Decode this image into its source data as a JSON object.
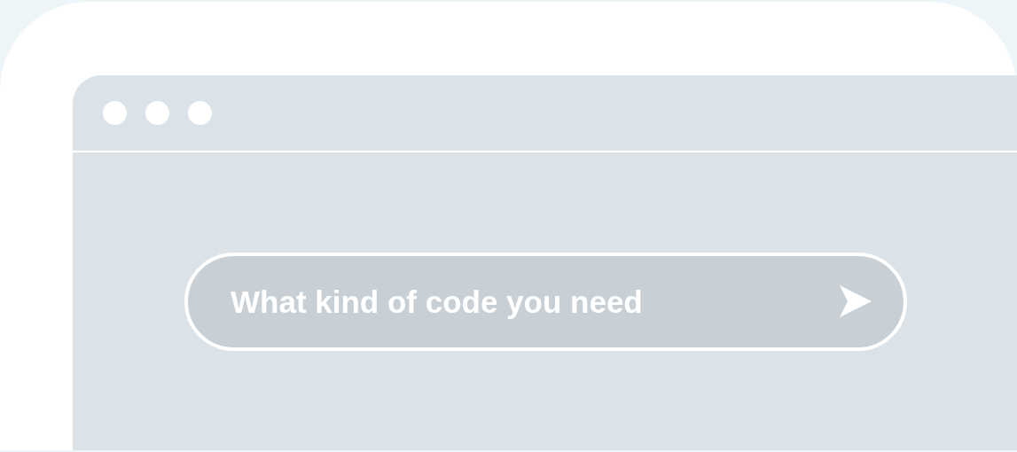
{
  "search": {
    "placeholder": "What kind of code you need"
  }
}
